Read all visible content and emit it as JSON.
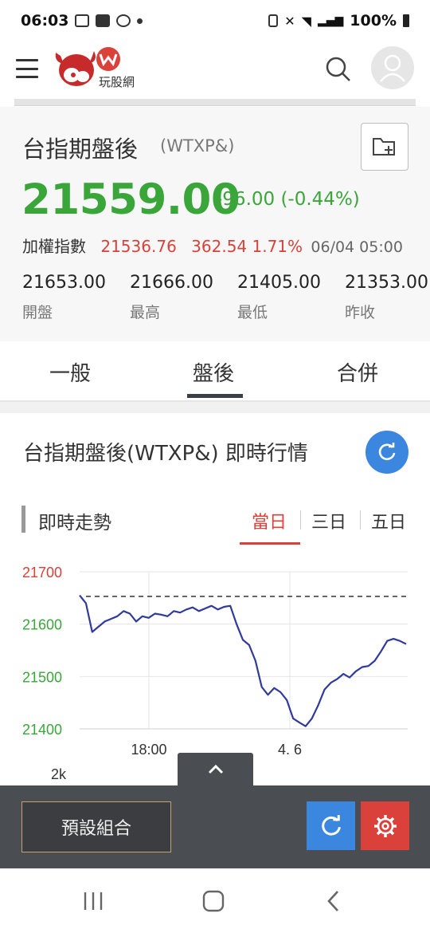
{
  "status_bar": {
    "time": "06:03",
    "battery": "100%"
  },
  "app": {
    "logo_text": "玩股網"
  },
  "quote": {
    "title": "台指期盤後",
    "code": "(WTXP&)",
    "price": "21559.00",
    "change": "-96.00 (-0.44%)",
    "index_label": "加權指數",
    "index_value": "21536.76",
    "index_change": "362.54 1.71%",
    "timestamp": "06/04 05:00",
    "stats": [
      {
        "value": "21653.00",
        "label": "開盤"
      },
      {
        "value": "21666.00",
        "label": "最高"
      },
      {
        "value": "21405.00",
        "label": "最低"
      },
      {
        "value": "21353.00",
        "label": "昨收"
      }
    ]
  },
  "tabs": [
    "一般",
    "盤後",
    "合併"
  ],
  "active_tab": "盤後",
  "section": {
    "title": "台指期盤後(WTXP&) 即時行情"
  },
  "trend": {
    "label": "即時走勢",
    "ranges": [
      "當日",
      "三日",
      "五日"
    ],
    "active_range": "當日"
  },
  "chart_data": {
    "type": "line",
    "title": "",
    "xlabel": "",
    "ylabel": "",
    "x_tick_labels": [
      "18:00",
      "4. 6"
    ],
    "y_tick_labels": [
      "21700",
      "21600",
      "21500",
      "21400"
    ],
    "ylim": [
      21400,
      21700
    ],
    "reference_line": 21653,
    "volume_axis_label": "2k",
    "series": [
      {
        "values": [
          21655,
          21640,
          21585,
          21595,
          21605,
          21610,
          21615,
          21625,
          21620,
          21605,
          21615,
          21612,
          21620,
          21618,
          21615,
          21625,
          21622,
          21628,
          21632,
          21625,
          21630,
          21635,
          21628,
          21633,
          21635,
          21600,
          21570,
          21560,
          21530,
          21480,
          21465,
          21478,
          21470,
          21455,
          21420,
          21412,
          21405,
          21420,
          21445,
          21475,
          21488,
          21495,
          21505,
          21498,
          21510,
          21518,
          21520,
          21530,
          21548,
          21568,
          21572,
          21568,
          21562
        ]
      }
    ],
    "colors": {
      "line": "#2f3a9c",
      "up_axis": "#d9413a",
      "down_axis": "#3aa63a"
    }
  },
  "bottom": {
    "preset_label": "預設組合"
  }
}
